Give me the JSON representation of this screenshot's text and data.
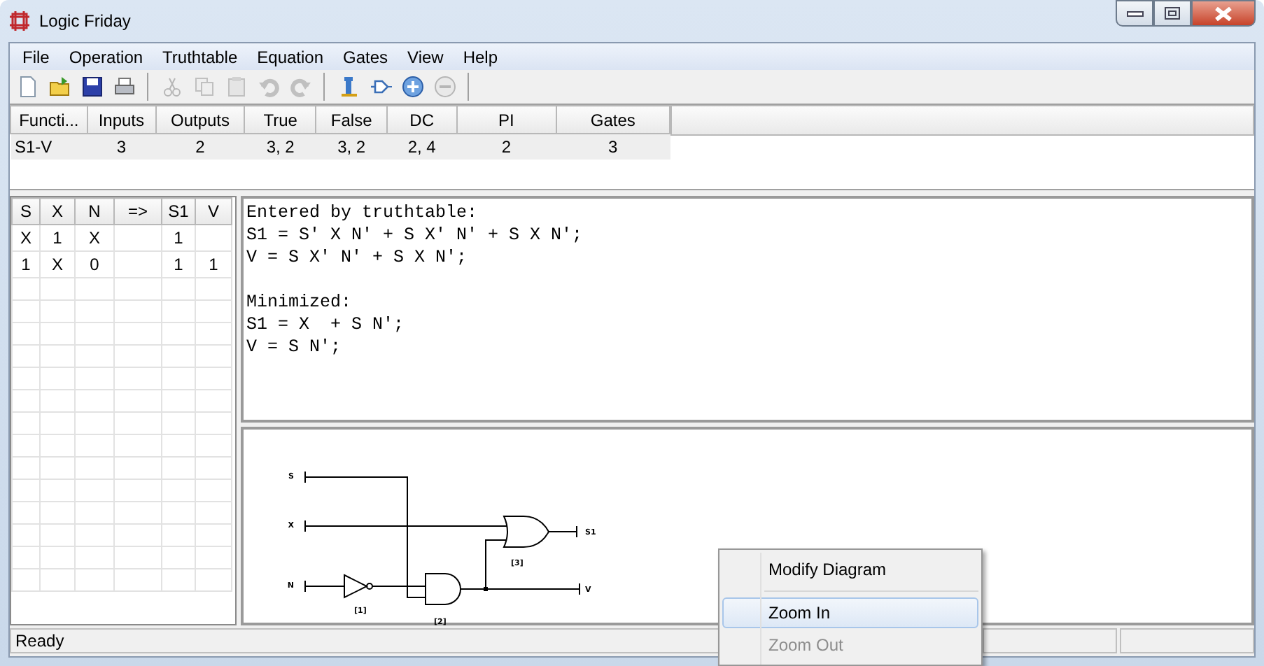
{
  "window": {
    "title": "Logic Friday"
  },
  "menu": [
    "File",
    "Operation",
    "Truthtable",
    "Equation",
    "Gates",
    "View",
    "Help"
  ],
  "toolbar": [
    {
      "kind": "new",
      "disabled": false
    },
    {
      "kind": "open",
      "disabled": false
    },
    {
      "kind": "save",
      "disabled": false
    },
    {
      "kind": "print",
      "disabled": false
    },
    {
      "kind": "separator"
    },
    {
      "kind": "cut",
      "disabled": true
    },
    {
      "kind": "copy",
      "disabled": true
    },
    {
      "kind": "paste",
      "disabled": true
    },
    {
      "kind": "undo",
      "disabled": true
    },
    {
      "kind": "redo",
      "disabled": true
    },
    {
      "kind": "separator"
    },
    {
      "kind": "component",
      "disabled": false
    },
    {
      "kind": "gate",
      "disabled": false
    },
    {
      "kind": "zoom_in",
      "disabled": false
    },
    {
      "kind": "zoom_out",
      "disabled": true
    },
    {
      "kind": "separator"
    }
  ],
  "summary": {
    "columns": [
      "Functi...",
      "Inputs",
      "Outputs",
      "True",
      "False",
      "DC",
      "PI",
      "Gates"
    ],
    "rows": [
      [
        "S1-V",
        "3",
        "2",
        "3, 2",
        "3, 2",
        "2, 4",
        "2",
        "3"
      ]
    ]
  },
  "truthtable": {
    "columns": [
      "S",
      "X",
      "N",
      "=>",
      "S1",
      "V"
    ],
    "rows": [
      [
        "X",
        "1",
        "X",
        "",
        "1",
        ""
      ],
      [
        "1",
        "X",
        "0",
        "",
        "1",
        "1"
      ]
    ]
  },
  "equations": [
    [
      "Entered by truthtable:",
      "S1 = S' X N' + S X' N' + S X N';",
      "V = S X' N' + S X N';"
    ],
    [
      "Minimized:",
      "S1 = X  + S N';",
      "V = S N';"
    ]
  ],
  "diagram": {
    "inputs": [
      "S",
      "X",
      "N"
    ],
    "outputs": [
      "S1",
      "V"
    ],
    "gates": [
      "[1]",
      "[2]",
      "[3]"
    ]
  },
  "context_menu": [
    {
      "kind": "item",
      "label": "Modify Diagram",
      "selected": false,
      "disabled": false
    },
    {
      "kind": "separator"
    },
    {
      "kind": "item",
      "label": "Zoom In",
      "selected": true,
      "disabled": false
    },
    {
      "kind": "item",
      "label": "Zoom Out",
      "selected": false,
      "disabled": true
    }
  ],
  "status_bar": {
    "text": "Ready"
  }
}
